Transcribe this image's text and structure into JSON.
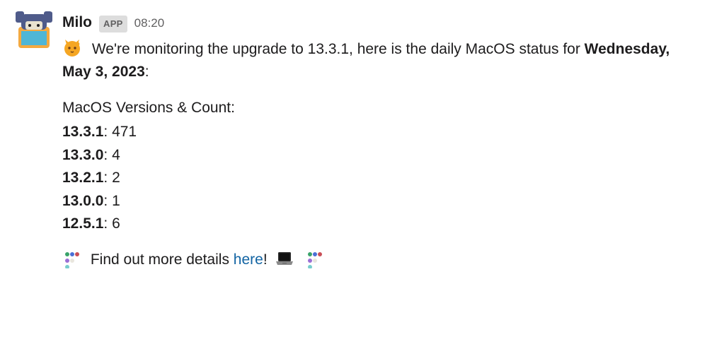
{
  "header": {
    "bot_name": "Milo",
    "badge": "APP",
    "time": "08:20"
  },
  "intro": {
    "pre": "We're monitoring the upgrade to 13.3.1, here is the daily MacOS status for ",
    "date": "Wednesday, May 3, 2023",
    "post": ":"
  },
  "versions_header": "MacOS Versions & Count:",
  "versions": [
    {
      "version": "13.3.1",
      "count": "471"
    },
    {
      "version": "13.3.0",
      "count": "4"
    },
    {
      "version": "13.2.1",
      "count": "2"
    },
    {
      "version": "13.0.0",
      "count": "1"
    },
    {
      "version": "12.5.1",
      "count": "6"
    }
  ],
  "footer": {
    "pre": "Find out more details ",
    "link": "here",
    "post": "! "
  },
  "icons": {
    "avatar": "bluey-avatar",
    "cat": "cat-thumbs-up-emoji",
    "dots": "loading-dots-emoji",
    "laptop": "laptop-emoji"
  }
}
